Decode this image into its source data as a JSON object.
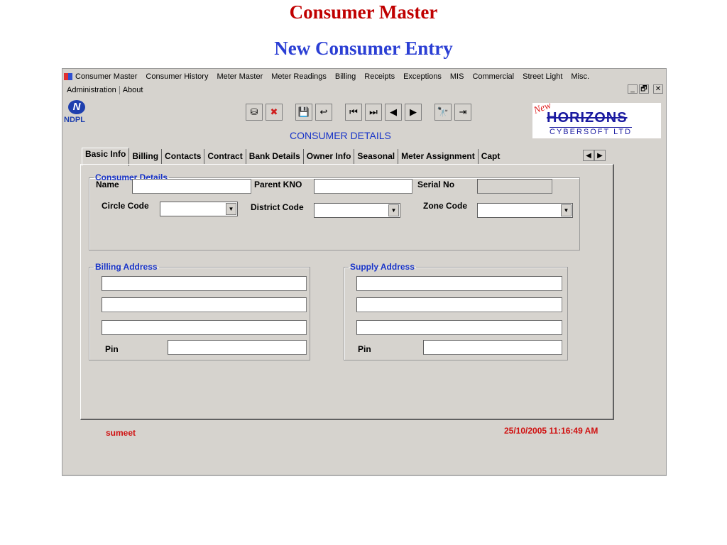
{
  "slide": {
    "title": "Consumer Master",
    "subtitle": "New Consumer Entry"
  },
  "menu": {
    "row1": [
      "Consumer Master",
      "Consumer History",
      "Meter Master",
      "Meter Readings",
      "Billing",
      "Receipts",
      "Exceptions",
      "MIS",
      "Commercial",
      "Street Light",
      "Misc."
    ],
    "row2": [
      "Administration",
      "About"
    ]
  },
  "window_controls": {
    "minimize": "_",
    "restore": "🗗",
    "close": "✕"
  },
  "logos": {
    "ndpl": "NDPL",
    "ndpl_mark": "N",
    "horizons_new": "New",
    "horizons_big": "HORIZONS",
    "horizons_small": "CYBERSOFT LTD"
  },
  "toolbar": {
    "icons": [
      "new-record-icon",
      "cancel-icon",
      "save-icon",
      "undo-icon",
      "first-record-icon",
      "last-record-icon",
      "previous-record-icon",
      "next-record-icon",
      "find-icon",
      "exit-icon"
    ],
    "glyphs": [
      "⛁",
      "✖",
      "💾",
      "↩",
      "⏮",
      "⏭",
      "◀",
      "▶",
      "🔭",
      "⇥"
    ]
  },
  "form": {
    "heading": "CONSUMER DETAILS",
    "tabs": [
      "Basic Info",
      "Billing",
      "Contacts",
      "Contract",
      "Bank Details",
      "Owner Info",
      "Seasonal",
      "Meter Assignment",
      "Capt"
    ],
    "tab_scroll": {
      "left": "◀",
      "right": "▶"
    },
    "consumer_details": {
      "legend": "Consumer Details",
      "name_label": "Name",
      "name_value": "",
      "parent_kno_label": "Parent KNO",
      "parent_kno_value": "",
      "serial_no_label": "Serial No",
      "serial_no_value": "",
      "circle_code_label": "Circle Code",
      "circle_code_value": "",
      "district_code_label": "District Code",
      "district_code_value": "",
      "zone_code_label": "Zone Code",
      "zone_code_value": ""
    },
    "billing_address": {
      "legend": "Billing Address",
      "line1": "",
      "line2": "",
      "line3": "",
      "pin_label": "Pin",
      "pin_value": ""
    },
    "supply_address": {
      "legend": "Supply Address",
      "line1": "",
      "line2": "",
      "line3": "",
      "pin_label": "Pin",
      "pin_value": ""
    }
  },
  "status": {
    "user": "sumeet",
    "timestamp": "25/10/2005 11:16:49 AM"
  },
  "colors": {
    "title_red": "#c00000",
    "title_blue": "#2b3fd4",
    "window_bg": "#d6d3ce",
    "legend_blue": "#1733c8",
    "status_red": "#d01010"
  }
}
